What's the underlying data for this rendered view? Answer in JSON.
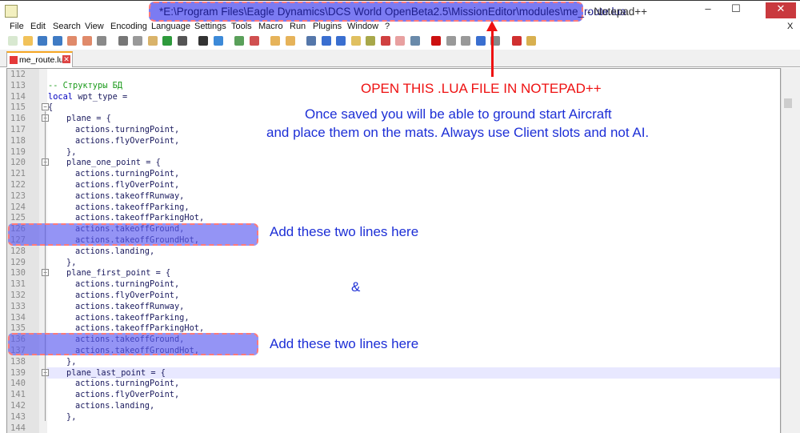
{
  "window": {
    "title_path": "*E:\\Program Files\\Eagle Dynamics\\DCS World OpenBeta2.5\\MissionEditor\\modules\\me_route.lua",
    "title_app": "- Notepad++",
    "minimize": "–",
    "maximize": "☐",
    "close": "✕",
    "doc_close": "X"
  },
  "menu": [
    "File",
    "Edit",
    "Search",
    "View",
    "Encoding",
    "Language",
    "Settings",
    "Tools",
    "Macro",
    "Run",
    "Plugins",
    "Window",
    "?"
  ],
  "toolbar_icons": [
    {
      "name": "new-file-icon",
      "color": "#d8e8d0"
    },
    {
      "name": "open-file-icon",
      "color": "#f1c25a"
    },
    {
      "name": "save-icon",
      "color": "#3f7bc4"
    },
    {
      "name": "save-all-icon",
      "color": "#3f7bc4"
    },
    {
      "name": "close-file-icon",
      "color": "#e08a6a"
    },
    {
      "name": "close-all-icon",
      "color": "#e08a6a"
    },
    {
      "name": "print-icon",
      "color": "#8a8a8a"
    },
    {
      "name": "cut-icon",
      "color": "#777"
    },
    {
      "name": "copy-icon",
      "color": "#999"
    },
    {
      "name": "paste-icon",
      "color": "#d9b36a"
    },
    {
      "name": "undo-icon",
      "color": "#2e9a3c"
    },
    {
      "name": "redo-icon",
      "color": "#555"
    },
    {
      "name": "find-icon",
      "color": "#333"
    },
    {
      "name": "replace-icon",
      "color": "#3d8ad8"
    },
    {
      "name": "zoom-in-icon",
      "color": "#5aa05a"
    },
    {
      "name": "zoom-out-icon",
      "color": "#d05050"
    },
    {
      "name": "sync-vertical-icon",
      "color": "#e6b35a"
    },
    {
      "name": "sync-horizontal-icon",
      "color": "#e6b35a"
    },
    {
      "name": "word-wrap-icon",
      "color": "#5577aa"
    },
    {
      "name": "show-all-chars-icon",
      "color": "#3a6fd0"
    },
    {
      "name": "indent-guide-icon",
      "color": "#3a6fd0"
    },
    {
      "name": "udl-icon",
      "color": "#e0c060"
    },
    {
      "name": "doc-map-icon",
      "color": "#a8a84a"
    },
    {
      "name": "function-list-icon",
      "color": "#d04040"
    },
    {
      "name": "folder-workspace-icon",
      "color": "#e8a0a0"
    },
    {
      "name": "monitor-icon",
      "color": "#6a8aaa"
    },
    {
      "name": "record-macro-icon",
      "color": "#cc1010"
    },
    {
      "name": "stop-macro-icon",
      "color": "#999"
    },
    {
      "name": "play-macro-icon",
      "color": "#999"
    },
    {
      "name": "run-macro-multiple-icon",
      "color": "#3a6fd0"
    },
    {
      "name": "save-macro-icon",
      "color": "#888"
    },
    {
      "name": "spellcheck-icon",
      "color": "#d03030"
    },
    {
      "name": "plugin-icon",
      "color": "#d8b050"
    }
  ],
  "tab": {
    "label": "me_route.lua"
  },
  "code": [
    {
      "n": "112",
      "t": "",
      "i": 0
    },
    {
      "n": "113",
      "t": "-- Структуры БД",
      "i": 0,
      "c": "cm"
    },
    {
      "n": "114",
      "t": "local",
      "t2": " wpt_type =",
      "i": 0,
      "c": "kw"
    },
    {
      "n": "115",
      "t": "{",
      "i": 0,
      "f": "box"
    },
    {
      "n": "116",
      "t": "plane = {",
      "i": 1,
      "f": "box"
    },
    {
      "n": "117",
      "t": "actions.turningPoint,",
      "i": 2
    },
    {
      "n": "118",
      "t": "actions.flyOverPoint,",
      "i": 2
    },
    {
      "n": "119",
      "t": "},",
      "i": 1,
      "f": "end"
    },
    {
      "n": "120",
      "t": "plane_one_point = {",
      "i": 1,
      "f": "box"
    },
    {
      "n": "121",
      "t": "actions.turningPoint,",
      "i": 2
    },
    {
      "n": "122",
      "t": "actions.flyOverPoint,",
      "i": 2
    },
    {
      "n": "123",
      "t": "actions.takeoffRunway,",
      "i": 2
    },
    {
      "n": "124",
      "t": "actions.takeoffParking,",
      "i": 2
    },
    {
      "n": "125",
      "t": "actions.takeoffParkingHot,",
      "i": 2
    },
    {
      "n": "126",
      "t": "actions.takeoffGround,",
      "i": 2
    },
    {
      "n": "127",
      "t": "actions.takeoffGroundHot,",
      "i": 2
    },
    {
      "n": "128",
      "t": "actions.landing,",
      "i": 2
    },
    {
      "n": "129",
      "t": "},",
      "i": 1,
      "f": "end"
    },
    {
      "n": "130",
      "t": "plane_first_point = {",
      "i": 1,
      "f": "box"
    },
    {
      "n": "131",
      "t": "actions.turningPoint,",
      "i": 2
    },
    {
      "n": "132",
      "t": "actions.flyOverPoint,",
      "i": 2
    },
    {
      "n": "133",
      "t": "actions.takeoffRunway,",
      "i": 2
    },
    {
      "n": "134",
      "t": "actions.takeoffParking,",
      "i": 2
    },
    {
      "n": "135",
      "t": "actions.takeoffParkingHot,",
      "i": 2
    },
    {
      "n": "136",
      "t": "actions.takeoffGround,",
      "i": 2
    },
    {
      "n": "137",
      "t": "actions.takeoffGroundHot,",
      "i": 2
    },
    {
      "n": "138",
      "t": "},",
      "i": 1,
      "f": "end"
    },
    {
      "n": "139",
      "t": "plane_last_point = {",
      "i": 1,
      "f": "box",
      "cur": true
    },
    {
      "n": "140",
      "t": "actions.turningPoint,",
      "i": 2
    },
    {
      "n": "141",
      "t": "actions.flyOverPoint,",
      "i": 2
    },
    {
      "n": "142",
      "t": "actions.landing,",
      "i": 2
    },
    {
      "n": "143",
      "t": "},",
      "i": 1,
      "f": "end"
    },
    {
      "n": "144",
      "t": "",
      "i": 0
    }
  ],
  "annotations": {
    "open_file": "OPEN THIS .LUA FILE IN NOTEPAD++",
    "info_line1": "Once saved you will be able to ground start Aircraft",
    "info_line2": "and place them on the mats. Always use Client slots and not AI.",
    "add_lines_1": "Add these two lines here",
    "ampersand": "&",
    "add_lines_2": "Add these two lines here"
  },
  "colors": {
    "highlight": "#7b7bf2",
    "highlight_border": "#ff7a7a",
    "note_blue": "#1d2fd6",
    "note_red": "#ee1111"
  }
}
